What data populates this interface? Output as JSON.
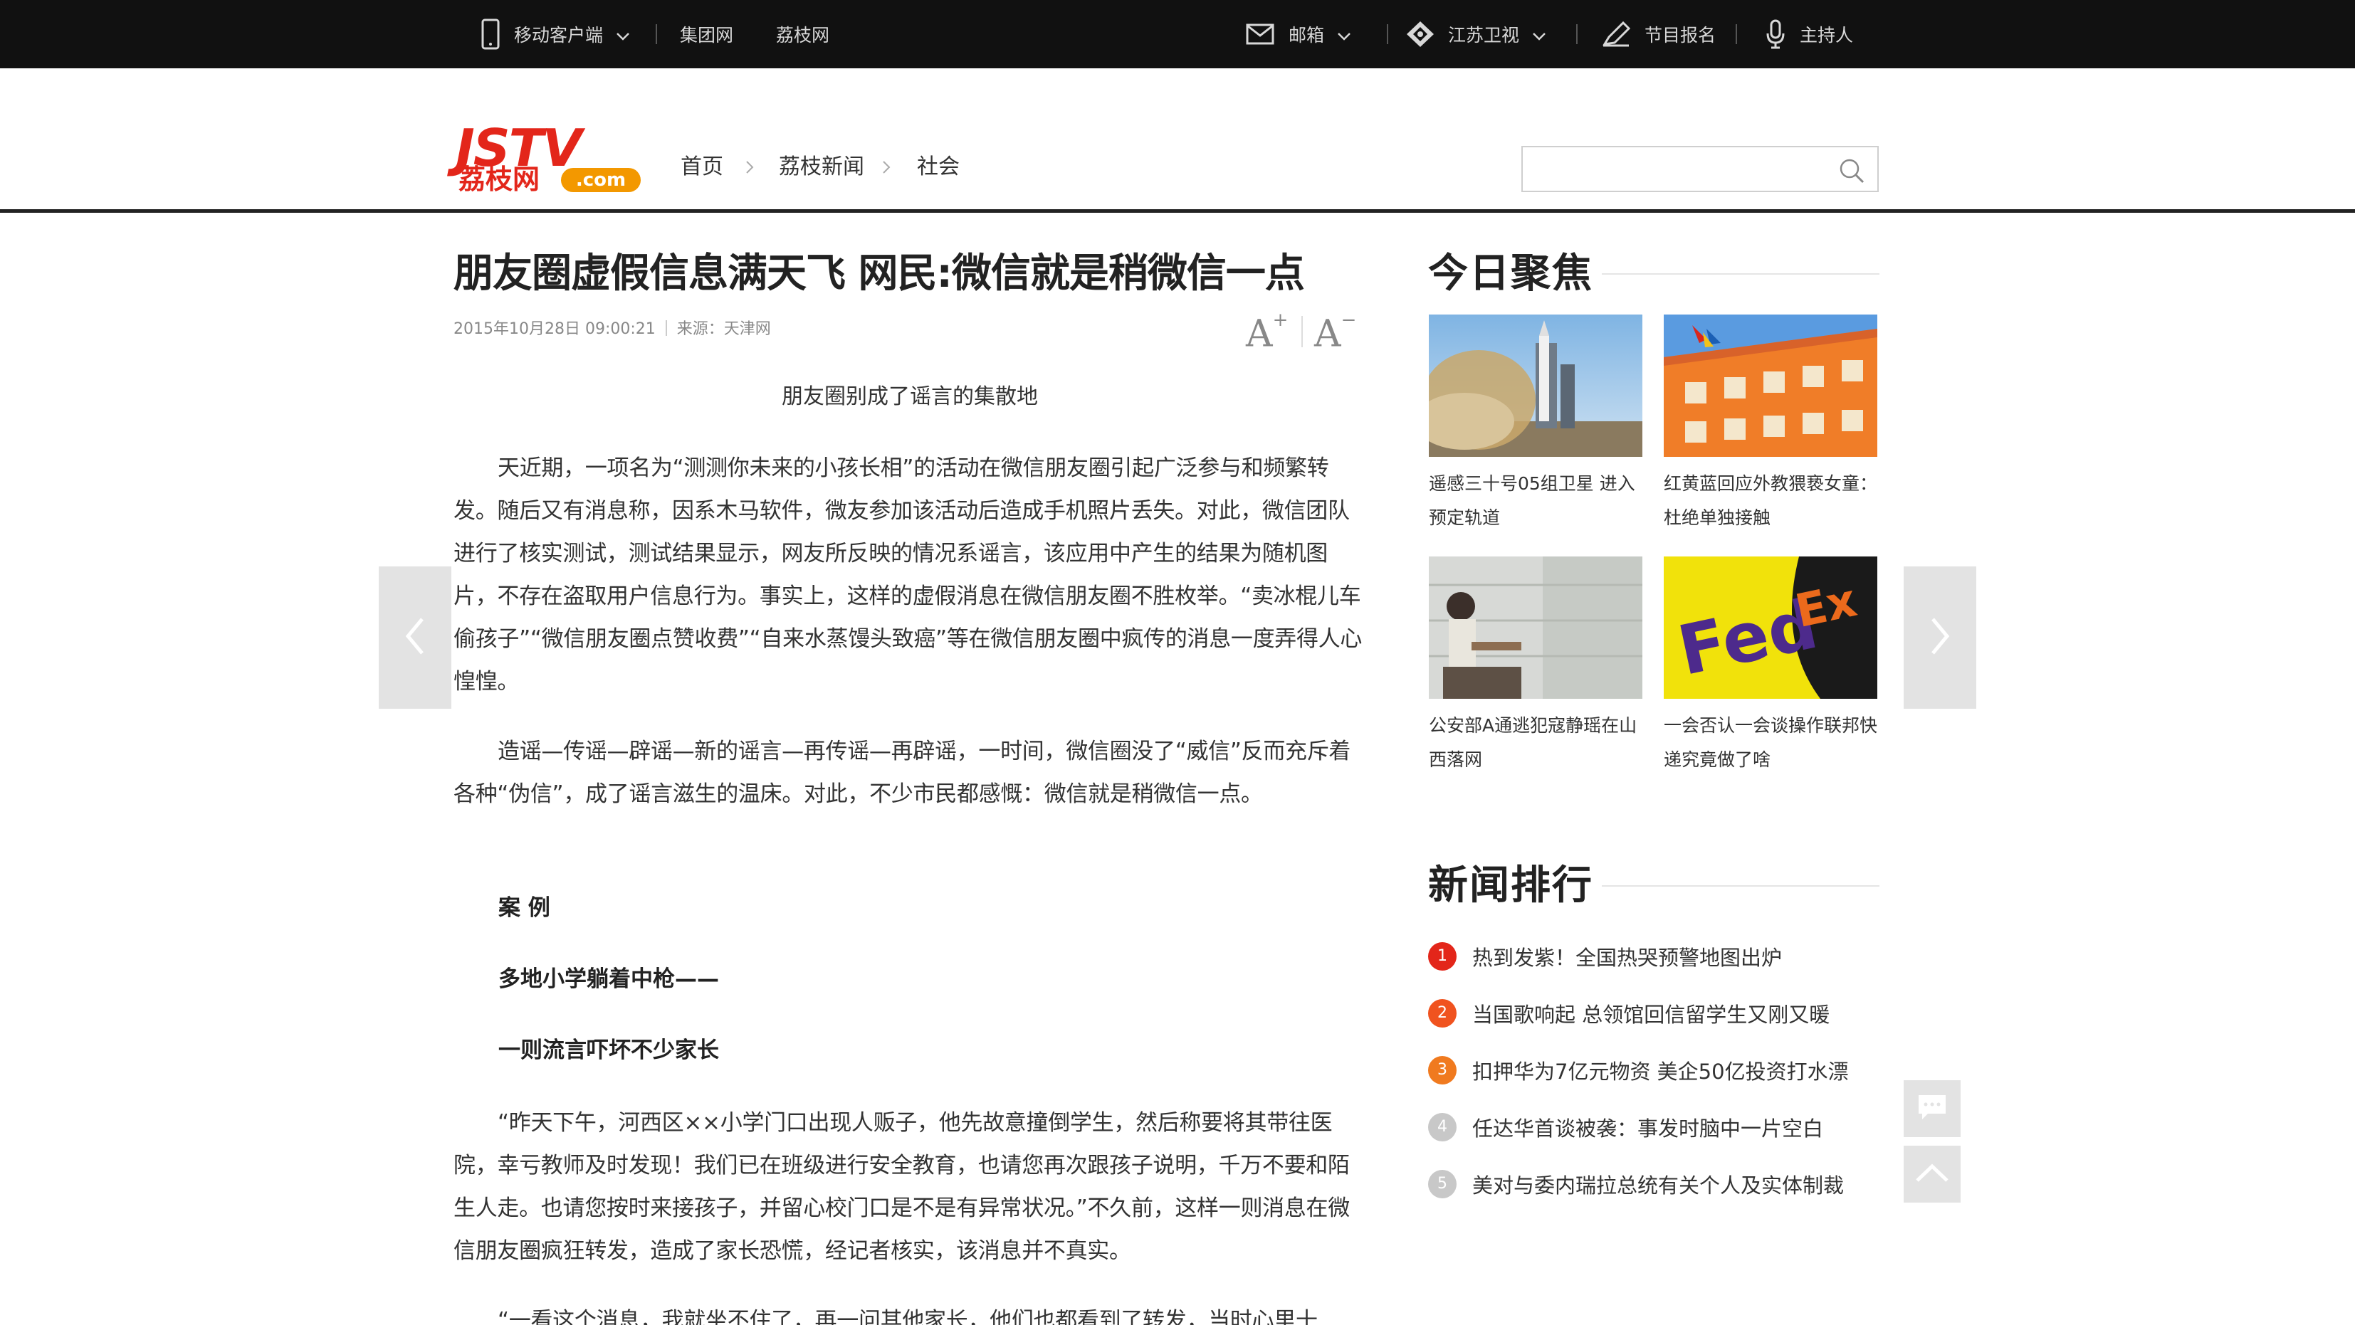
{
  "topbar": {
    "mobile_label": "移动客户端",
    "group_label": "集团网",
    "lizhi_label": "荔枝网",
    "mail_label": "邮箱",
    "jstv_label": "江苏卫视",
    "signup_label": "节目报名",
    "host_label": "主持人"
  },
  "logo": {
    "main": "JSTV",
    "cn": "荔枝网",
    "com": ".com"
  },
  "breadcrumb": [
    "首页",
    "荔枝新闻",
    "社会"
  ],
  "search": {
    "value": "",
    "placeholder": ""
  },
  "article": {
    "title": "朋友圈虚假信息满天飞 网民:微信就是稍微信一点",
    "date": "2015年10月28日 09:00:21",
    "source": "来源：天津网",
    "font_up": "A",
    "font_down": "A",
    "font_up_sign": "+",
    "font_down_sign": "−",
    "caption": "朋友圈别成了谣言的集散地",
    "p1": "天近期，一项名为“测测你未来的小孩长相”的活动在微信朋友圈引起广泛参与和频繁转发。随后又有消息称，因系木马软件，微友参加该活动后造成手机照片丢失。对此，微信团队进行了核实测试，测试结果显示，网友所反映的情况系谣言，该应用中产生的结果为随机图片，不存在盗取用户信息行为。事实上，这样的虚假消息在微信朋友圈不胜枚举。“卖冰棍儿车偷孩子”“微信朋友圈点赞收费”“自来水蒸馒头致癌”等在微信朋友圈中疯传的消息一度弄得人心惶惶。",
    "p2": "造谣—传谣—辟谣—新的谣言—再传谣—再辟谣，一时间，微信圈没了“威信”反而充斥着各种“伪信”，成了谣言滋生的温床。对此，不少市民都感慨：微信就是稍微信一点。",
    "h1": "案 例",
    "h2": "多地小学躺着中枪——",
    "h3": "一则流言吓坏不少家长",
    "p3": "“昨天下午，河西区××小学门口出现人贩子，他先故意撞倒学生，然后称要将其带往医院，幸亏教师及时发现！我们已在班级进行安全教育，也请您再次跟孩子说明，千万不要和陌生人走。也请您按时来接孩子，并留心校门口是不是有异常状况。”不久前，这样一则消息在微信朋友圈疯狂转发，造成了家长恐慌，经记者核实，该消息并不真实。",
    "p4": "“一看这个消息，我就坐不住了，再一问其他家长，他们也都看到了转发，当时心里十"
  },
  "focus": {
    "title": "今日聚焦",
    "items": [
      {
        "caption": "遥感三十号05组卫星 进入预定轨道"
      },
      {
        "caption": "红黄蓝回应外教猥亵女童：杜绝单独接触"
      },
      {
        "caption": "公安部A通逃犯寇静瑶在山西落网"
      },
      {
        "caption": "一会否认一会谈操作联邦快递究竟做了啥"
      }
    ]
  },
  "ranking": {
    "title": "新闻排行",
    "items": [
      {
        "num": "1",
        "text": "热到发紫！全国热哭预警地图出炉",
        "color": "#e3261a"
      },
      {
        "num": "2",
        "text": "当国歌响起 总领馆回信留学生又刚又暖",
        "color": "#f0531f"
      },
      {
        "num": "3",
        "text": "扣押华为7亿元物资 美企50亿投资打水漂",
        "color": "#f07a1f"
      },
      {
        "num": "4",
        "text": "任达华首谈被袭：事发时脑中一片空白",
        "color": "#c8c8c8"
      },
      {
        "num": "5",
        "text": "美对与委内瑞拉总统有关个人及实体制裁",
        "color": "#c8c8c8"
      }
    ]
  }
}
